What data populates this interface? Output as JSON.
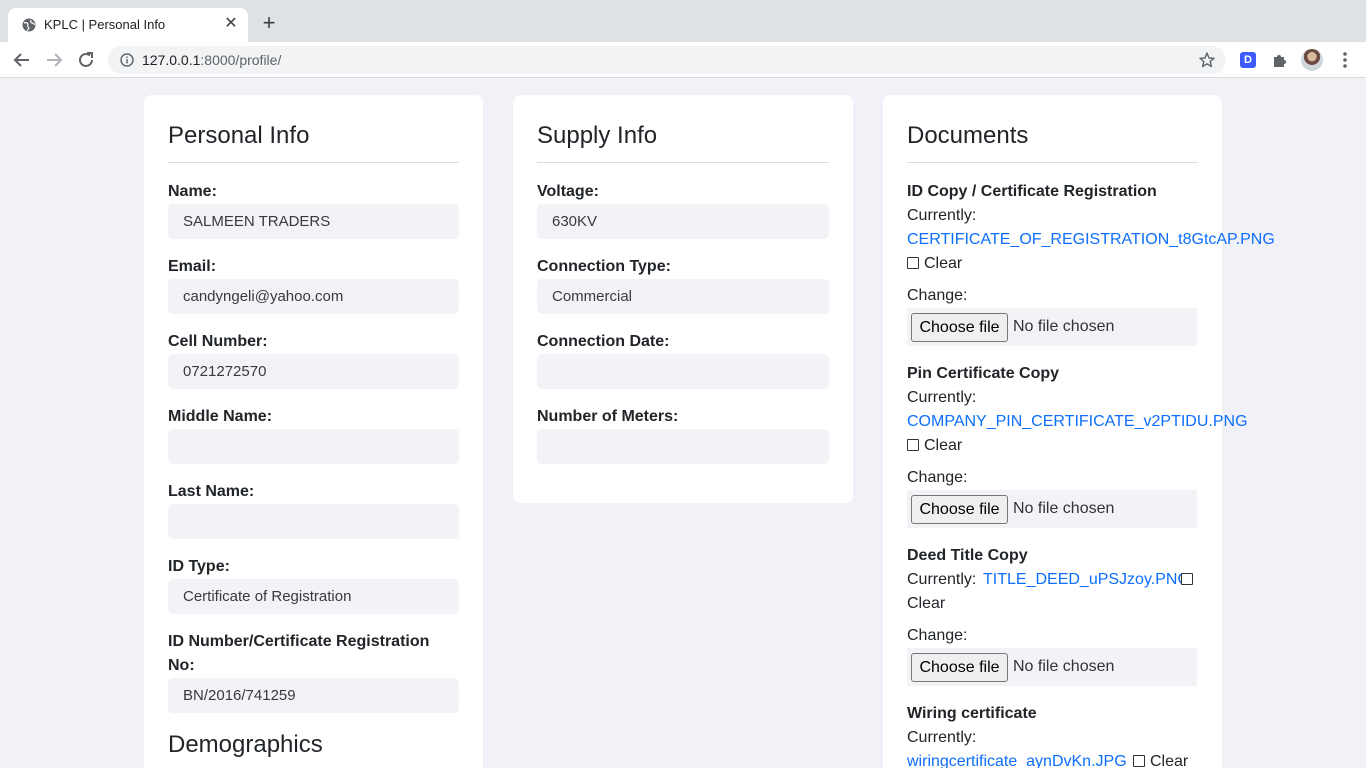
{
  "browser": {
    "tab_title": "KPLC | Personal Info",
    "url_host": "127.0.0.1",
    "url_rest": ":8000/profile/",
    "extension_badge": "D"
  },
  "personal": {
    "title": "Personal Info",
    "fields": [
      {
        "label": "Name:",
        "value": "SALMEEN TRADERS"
      },
      {
        "label": "Email:",
        "value": "candyngeli@yahoo.com"
      },
      {
        "label": "Cell Number:",
        "value": "0721272570"
      },
      {
        "label": "Middle Name:",
        "value": ""
      },
      {
        "label": "Last Name:",
        "value": ""
      },
      {
        "label": "ID Type:",
        "value": "Certificate of Registration"
      }
    ],
    "id_number_label_line1": "ID Number/Certificate Registration",
    "id_number_label_line2": "No:",
    "id_number_value": "BN/2016/741259",
    "demographics_title": "Demographics"
  },
  "supply": {
    "title": "Supply Info",
    "fields": [
      {
        "label": "Voltage:",
        "value": "630KV"
      },
      {
        "label": "Connection Type:",
        "value": "Commercial"
      },
      {
        "label": "Connection Date:",
        "value": ""
      },
      {
        "label": "Number of Meters:",
        "value": ""
      }
    ]
  },
  "documents": {
    "title": "Documents",
    "currently_label": "Currently:",
    "change_label": "Change:",
    "clear_label": "Clear",
    "choose_file_label": "Choose file",
    "no_file_label": "No file chosen",
    "items": [
      {
        "label": "ID Copy / Certificate Registration",
        "file": "CERTIFICATE_OF_REGISTRATION_t8GtcAP.PNG"
      },
      {
        "label": "Pin Certificate Copy",
        "file": "COMPANY_PIN_CERTIFICATE_v2PTIDU.PNG"
      },
      {
        "label": "Deed Title Copy",
        "file": "TITLE_DEED_uPSJzoy.PNG"
      },
      {
        "label": "Wiring certificate",
        "file": "wiringcertificate_aynDvKn.JPG"
      }
    ]
  }
}
